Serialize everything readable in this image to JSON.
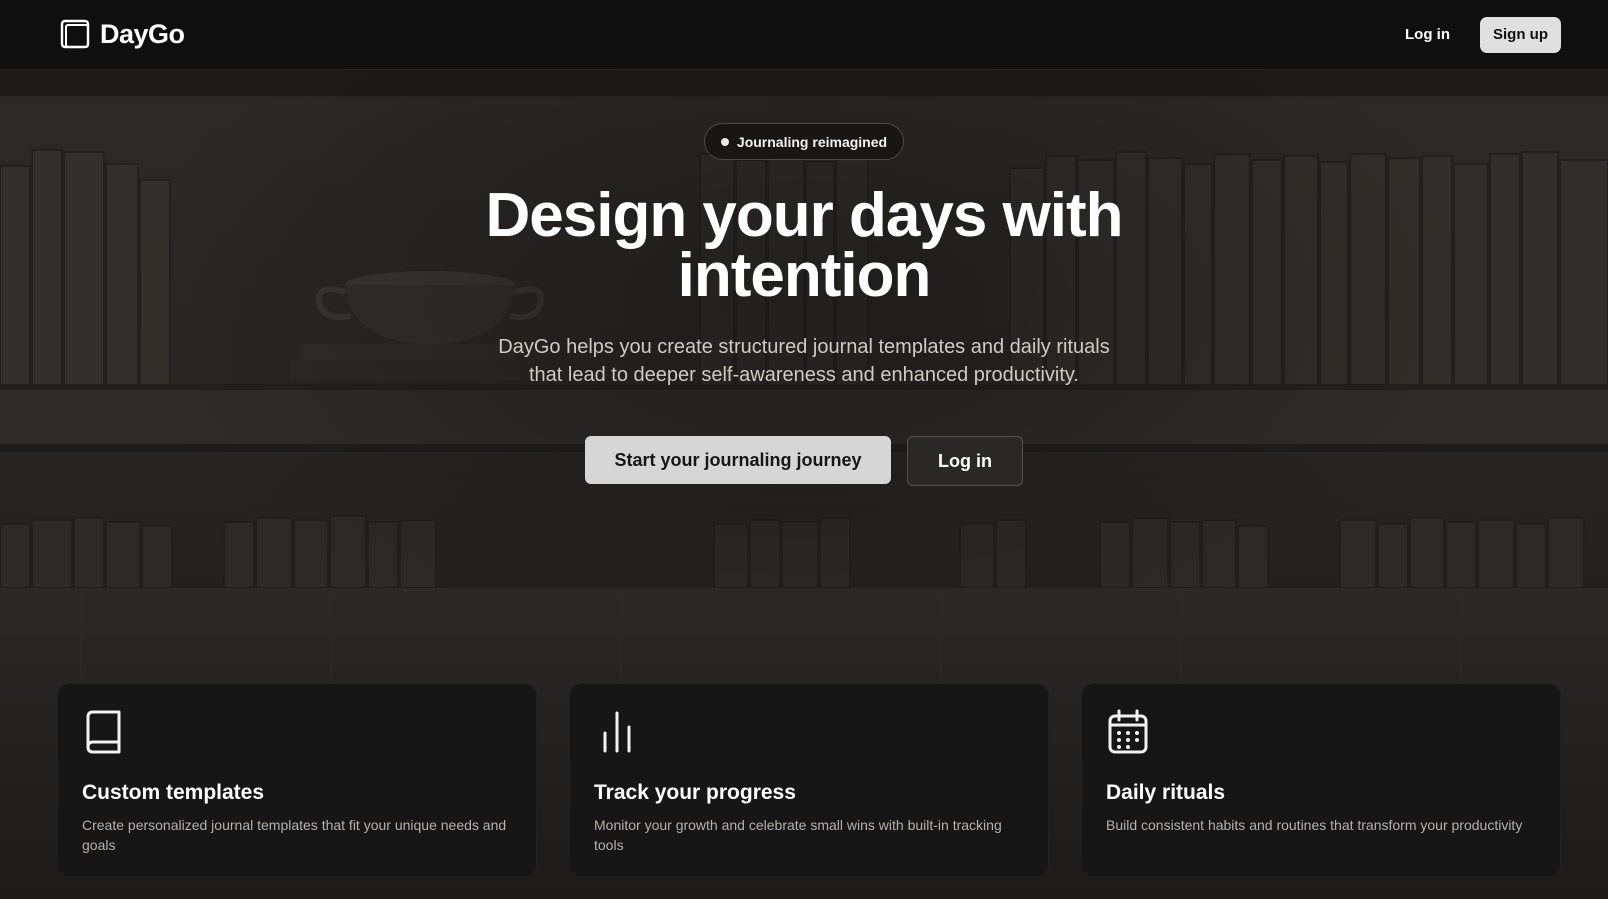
{
  "header": {
    "brand_name": "DayGo",
    "login_label": "Log in",
    "signup_label": "Sign up"
  },
  "hero": {
    "badge": "Journaling reimagined",
    "title_line1": "Design your days with",
    "title_line2": "intention",
    "subtitle_line1": "DayGo helps you create structured journal templates and daily rituals",
    "subtitle_line2": "that lead to deeper self-awareness and enhanced productivity.",
    "primary_cta": "Start your journaling journey",
    "secondary_cta": "Log in"
  },
  "features": [
    {
      "icon": "book-icon",
      "title": "Custom templates",
      "description": "Create personalized journal templates that fit your unique needs and goals"
    },
    {
      "icon": "bar-chart-icon",
      "title": "Track your progress",
      "description": "Monitor your growth and celebrate small wins with built-in tracking tools"
    },
    {
      "icon": "calendar-icon",
      "title": "Daily rituals",
      "description": "Build consistent habits and routines that transform your productivity"
    }
  ],
  "colors": {
    "header_bg": "#0f0f0f",
    "hero_bg": "#2a2724",
    "card_bg": "#161616",
    "primary_button": "#d6d6d6"
  }
}
